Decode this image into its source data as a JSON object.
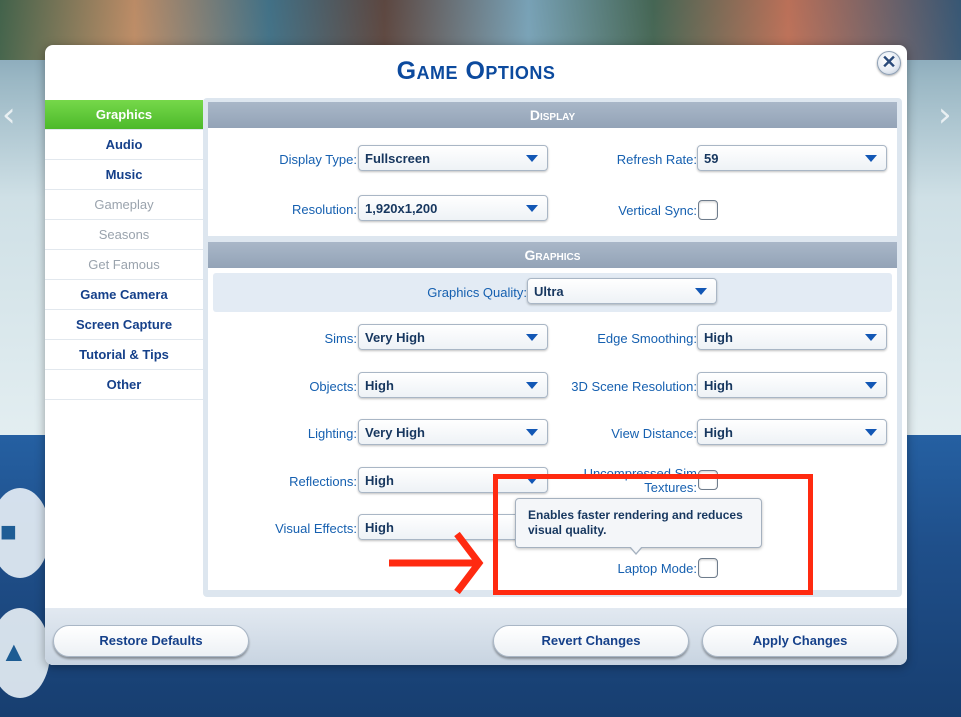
{
  "dialog": {
    "title": "Game Options",
    "close_label": "✕"
  },
  "nav": {
    "items": [
      {
        "label": "Graphics",
        "state": "active"
      },
      {
        "label": "Audio",
        "state": "normal"
      },
      {
        "label": "Music",
        "state": "normal"
      },
      {
        "label": "Gameplay",
        "state": "disabled"
      },
      {
        "label": "Seasons",
        "state": "disabled"
      },
      {
        "label": "Get Famous",
        "state": "disabled"
      },
      {
        "label": "Game Camera",
        "state": "normal"
      },
      {
        "label": "Screen Capture",
        "state": "normal"
      },
      {
        "label": "Tutorial & Tips",
        "state": "normal"
      },
      {
        "label": "Other",
        "state": "normal"
      }
    ]
  },
  "display": {
    "header": "Display",
    "display_type": {
      "label": "Display Type:",
      "value": "Fullscreen"
    },
    "refresh_rate": {
      "label": "Refresh Rate:",
      "value": "59"
    },
    "resolution": {
      "label": "Resolution:",
      "value": "1,920x1,200"
    },
    "vertical_sync": {
      "label": "Vertical Sync:",
      "checked": false
    }
  },
  "graphics": {
    "header": "Graphics",
    "quality": {
      "label": "Graphics Quality:",
      "value": "Ultra"
    },
    "sims": {
      "label": "Sims:",
      "value": "Very High"
    },
    "edge_smoothing": {
      "label": "Edge Smoothing:",
      "value": "High"
    },
    "objects": {
      "label": "Objects:",
      "value": "High"
    },
    "scene_resolution": {
      "label": "3D Scene Resolution:",
      "value": "High"
    },
    "lighting": {
      "label": "Lighting:",
      "value": "Very High"
    },
    "view_distance": {
      "label": "View Distance:",
      "value": "High"
    },
    "reflections": {
      "label": "Reflections:",
      "value": "High"
    },
    "uncompressed_textures": {
      "label_line1": "Uncompressed Sim",
      "label_line2": "Textures:",
      "checked": false
    },
    "visual_effects": {
      "label": "Visual Effects:",
      "value": "High"
    },
    "laptop_mode": {
      "label": "Laptop Mode:",
      "checked": false
    }
  },
  "tooltip": {
    "text": "Enables faster rendering and reduces visual quality."
  },
  "footer": {
    "restore_label": "Restore Defaults",
    "revert_label": "Revert Changes",
    "apply_label": "Apply Changes"
  },
  "colors": {
    "title_blue": "#0c4a9e",
    "active_tab_green": "#4cb92a",
    "annotation_red": "#ff2a10"
  }
}
